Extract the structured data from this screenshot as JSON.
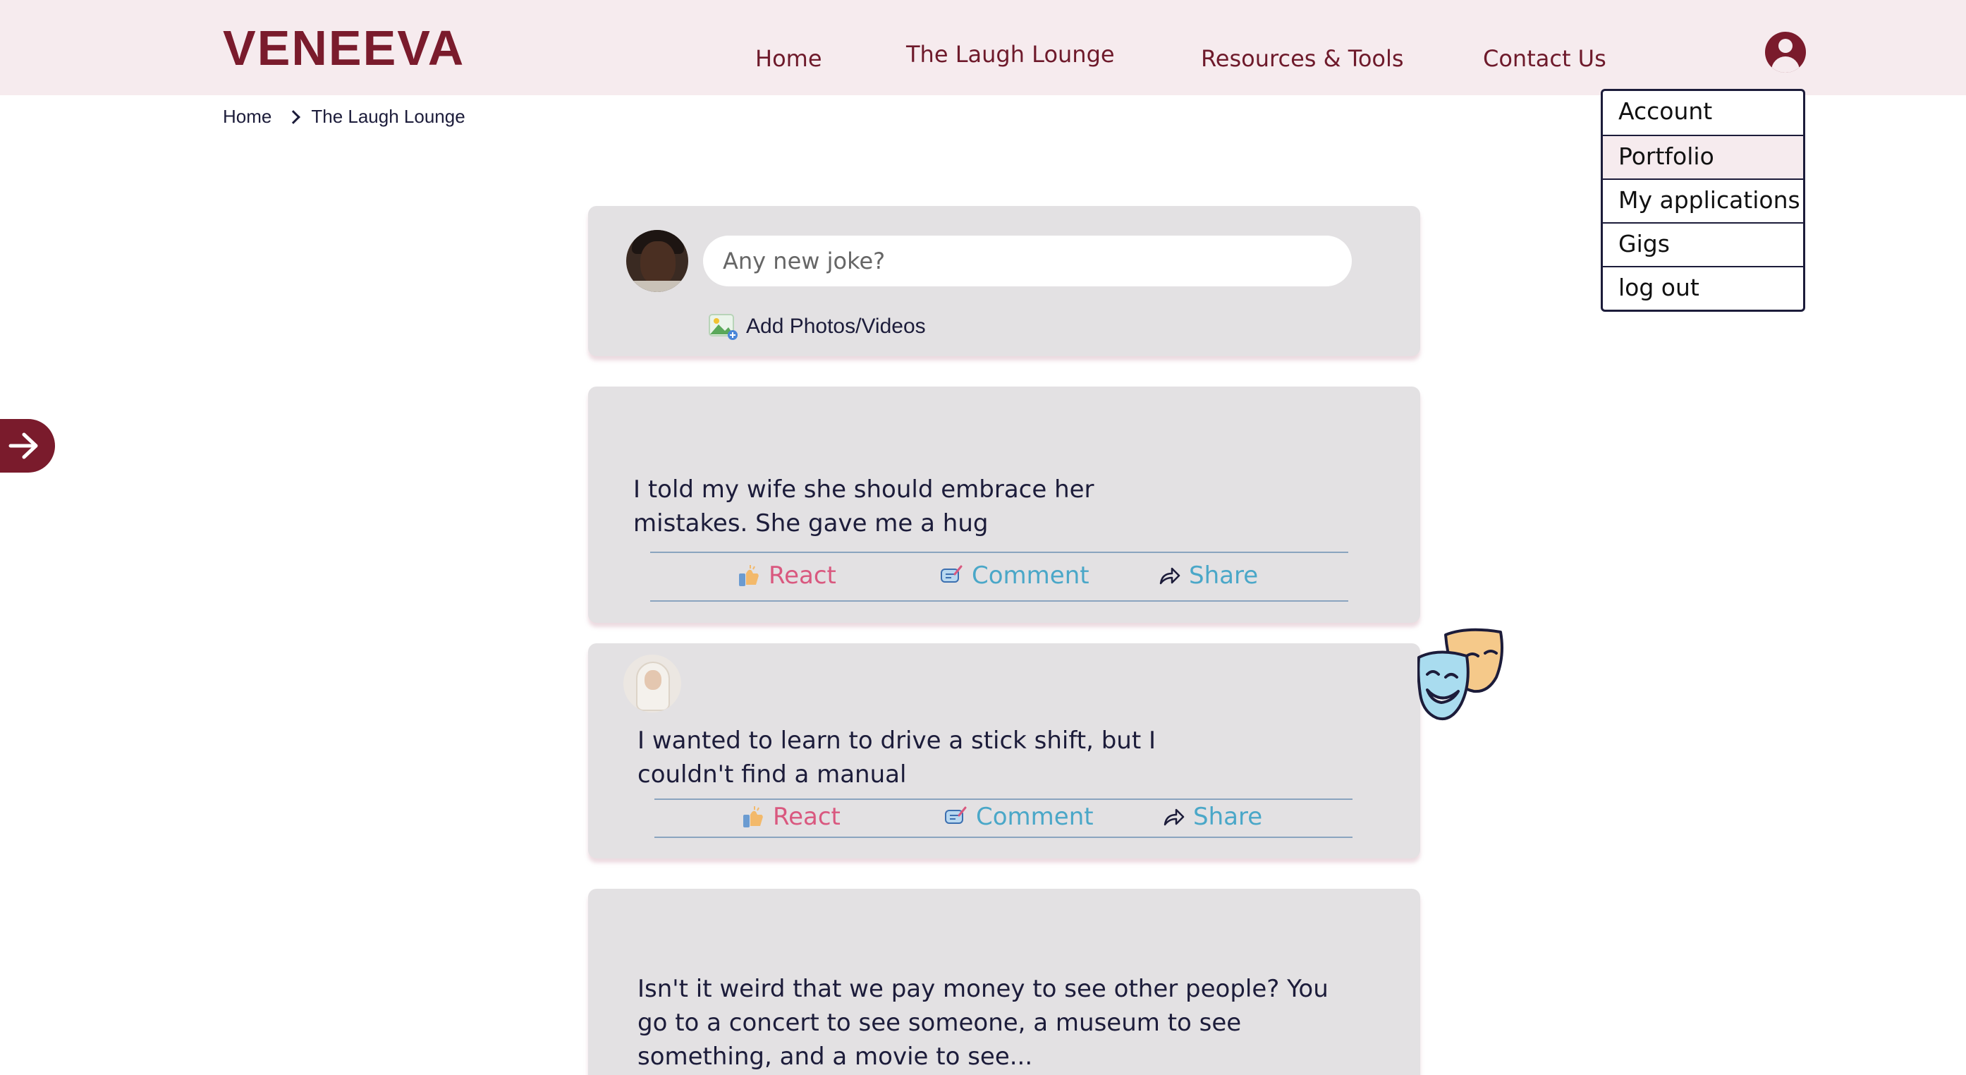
{
  "brand": {
    "logo": "VENEEVA",
    "accent": "#7a1b2c",
    "header_bg": "#f6ebee"
  },
  "nav": {
    "home": "Home",
    "laugh_lounge": "The Laugh Lounge",
    "resources": "Resources & Tools",
    "contact": "Contact Us"
  },
  "user_menu": {
    "icon": "user-circle-icon",
    "items": [
      "Account",
      "Portfolio",
      "My applications",
      "Gigs",
      "log out"
    ],
    "highlighted": "Portfolio"
  },
  "breadcrumb": {
    "home": "Home",
    "current": "The Laugh Lounge"
  },
  "composer": {
    "placeholder": "Any new joke?",
    "add_media": "Add Photos/Videos"
  },
  "actions": {
    "react": "React",
    "comment": "Comment",
    "share": "Share"
  },
  "posts": [
    {
      "line1": "I told my wife she should embrace her",
      "line2": "mistakes. She gave me a hug"
    },
    {
      "line1": "I wanted to learn to drive a stick shift, but I",
      "line2": "couldn't find a manual"
    },
    {
      "line1": "Isn't it weird that we pay money to see other people? You",
      "line2": "go to a concert to see someone, a museum to see",
      "line3": "something, and a movie to see..."
    }
  ]
}
